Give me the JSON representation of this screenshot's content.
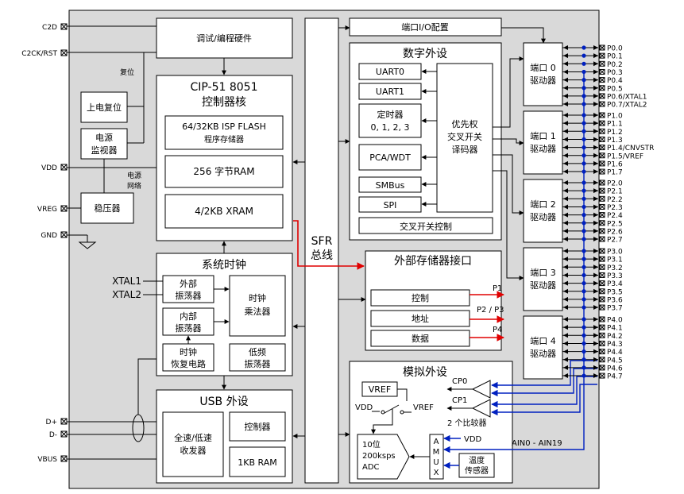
{
  "left_pins": {
    "c2d": "C2D",
    "c2ck_rst": "C2CK/RST",
    "vdd": "VDD",
    "vreg": "VREG",
    "gnd": "GND",
    "xtal1": "XTAL1",
    "xtal2": "XTAL2",
    "dplus": "D+",
    "dminus": "D-",
    "vbus": "VBUS"
  },
  "labels": {
    "reset": "复位",
    "power_net_1": "电源",
    "power_net_2": "网络",
    "p1": "P1",
    "p2p3": "P2 / P3",
    "p4": "P4",
    "cp0": "CP0",
    "cp1": "CP1",
    "comparators": "2 个比较器",
    "ain": "AIN0 - AIN19",
    "vdd_inner": "VDD",
    "vref_sw": "VREF",
    "vdd_sw": "VDD",
    "vdd_mux": "VDD"
  },
  "blocks": {
    "debug": "调试/编程硬件",
    "cpu_title": "CIP-51 8051",
    "cpu_sub": "控制器核",
    "flash_1": "64/32KB ISP FLASH",
    "flash_2": "程序存储器",
    "ram": "256 字节RAM",
    "xram": "4/2KB XRAM",
    "por_1": "上电复位",
    "supmon_1": "电源",
    "supmon_2": "监视器",
    "regulator": "稳压器",
    "sysclk": "系统时钟",
    "extosc_1": "外部",
    "extosc_2": "振荡器",
    "intosc_1": "内部",
    "intosc_2": "振荡器",
    "clkmul_1": "时钟",
    "clkmul_2": "乘法器",
    "clkrec_1": "时钟",
    "clkrec_2": "恢复电路",
    "lfosc_1": "低频",
    "lfosc_2": "振荡器",
    "usb": "USB 外设",
    "transceiver_1": "全速/低速",
    "transceiver_2": "收发器",
    "usb_ctrl": "控制器",
    "usb_ram": "1KB RAM",
    "sfr_1": "SFR",
    "sfr_2": "总线",
    "port_io": "端口I/O配置",
    "digital": "数字外设",
    "uart0": "UART0",
    "uart1": "UART1",
    "timers_1": "定时器",
    "timers_2": "0, 1, 2, 3",
    "pca": "PCA/WDT",
    "smbus": "SMBus",
    "spi": "SPI",
    "crossbar_1": "优先权",
    "crossbar_2": "交叉开关",
    "crossbar_3": "译码器",
    "crossbar_ctrl": "交叉开关控制",
    "emif": "外部存储器接口",
    "emif_ctrl": "控制",
    "emif_addr": "地址",
    "emif_data": "数据",
    "analog": "模拟外设",
    "vref": "VREF",
    "adc_1": "10位",
    "adc_2": "200ksps",
    "adc_3": "ADC",
    "amux_a": "A",
    "amux_m": "M",
    "amux_u": "U",
    "amux_x": "X",
    "temp_1": "温度",
    "temp_2": "传感器"
  },
  "ports": [
    {
      "line1": "端口 0",
      "line2": "驱动器",
      "pins": [
        "P0.0",
        "P0.1",
        "P0.2",
        "P0.3",
        "P0.4",
        "P0.5",
        "P0.6/XTAL1",
        "P0.7/XTAL2"
      ]
    },
    {
      "line1": "端口 1",
      "line2": "驱动器",
      "pins": [
        "P1.0",
        "P1.1",
        "P1.2",
        "P1.3",
        "P1.4/CNVSTR",
        "P1.5/VREF",
        "P1.6",
        "P1.7"
      ]
    },
    {
      "line1": "端口 2",
      "line2": "驱动器",
      "pins": [
        "P2.0",
        "P2.1",
        "P2.2",
        "P2.3",
        "P2.4",
        "P2.5",
        "P2.6",
        "P2.7"
      ]
    },
    {
      "line1": "端口 3",
      "line2": "驱动器",
      "pins": [
        "P3.0",
        "P3.1",
        "P3.2",
        "P3.3",
        "P3.4",
        "P3.5",
        "P3.6",
        "P3.7"
      ]
    },
    {
      "line1": "端口 4",
      "line2": "驱动器",
      "pins": [
        "P4.0",
        "P4.1",
        "P4.2",
        "P4.3",
        "P4.4",
        "P4.5",
        "P4.6",
        "P4.7"
      ]
    }
  ],
  "colors": {
    "chip_background": "#d9d9d9",
    "bus_red": "#e00000",
    "analog_blue": "#0020c0"
  }
}
